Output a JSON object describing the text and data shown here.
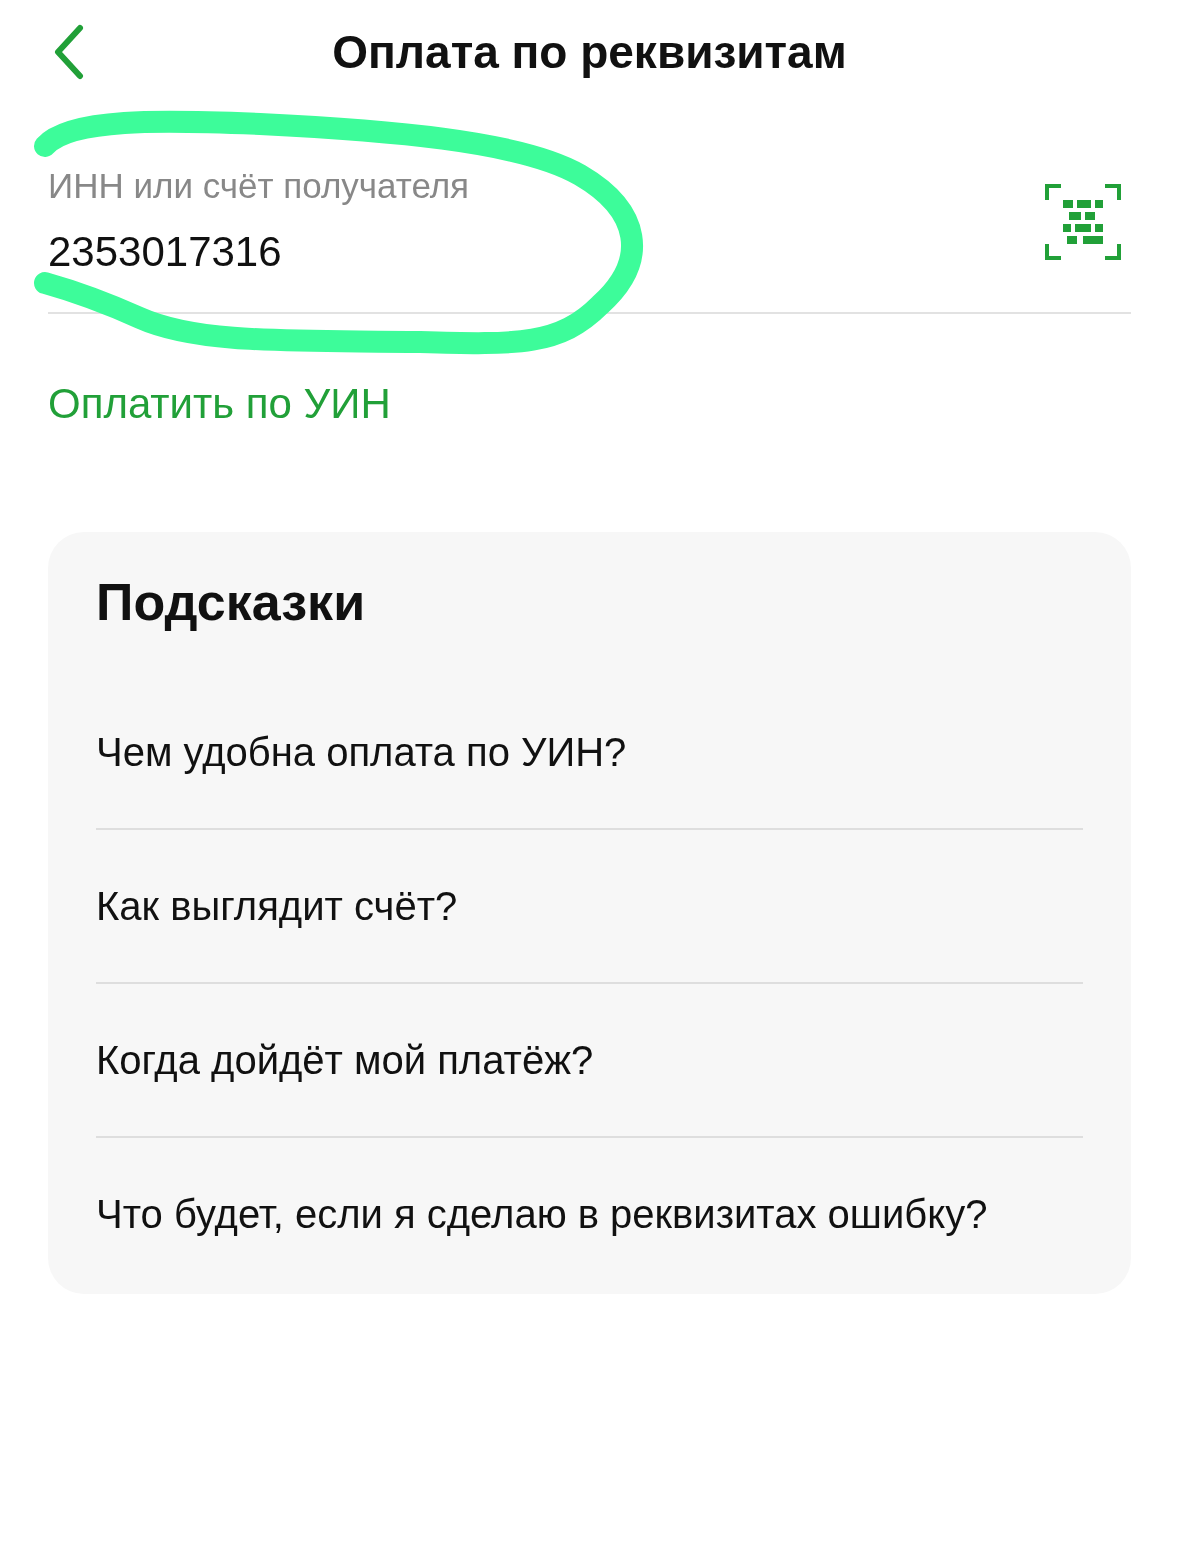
{
  "header": {
    "title": "Оплата по реквизитам"
  },
  "field": {
    "label": "ИНН или счёт получателя",
    "value": "2353017316"
  },
  "link": "Оплатить по УИН",
  "hints": {
    "title": "Подсказки",
    "items": [
      "Чем удобна оплата по УИН?",
      "Как выглядит счёт?",
      "Когда дойдёт мой платёж?",
      "Что будет, если я сделаю в реквизитах ошибку?"
    ]
  }
}
